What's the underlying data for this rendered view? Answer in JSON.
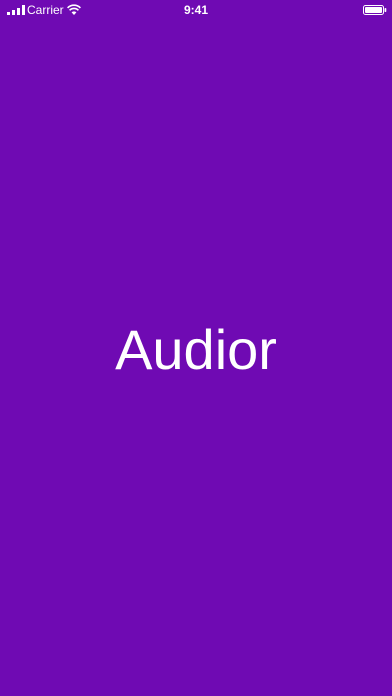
{
  "status_bar": {
    "carrier": "Carrier",
    "time": "9:41",
    "icons": [
      "signal-icon",
      "wifi-icon",
      "battery-icon"
    ]
  },
  "splash": {
    "app_name": "Audior",
    "background_color": "#6f0ab3",
    "text_color": "#ffffff"
  }
}
